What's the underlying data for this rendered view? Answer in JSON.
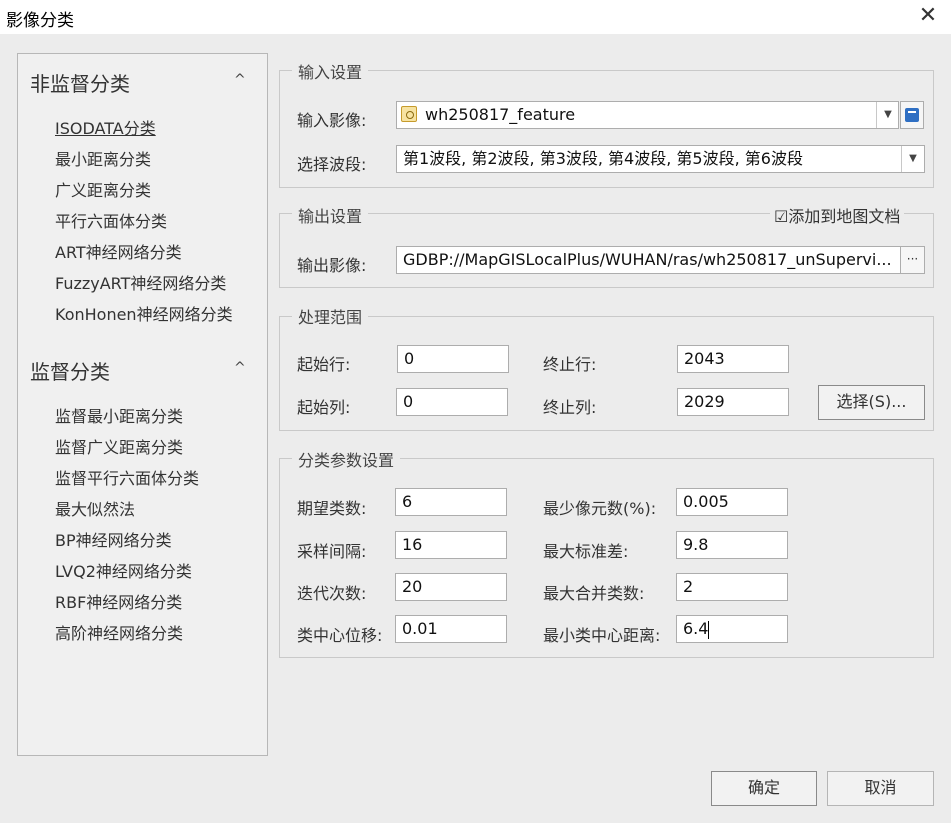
{
  "window": {
    "title": "影像分类",
    "close_glyph": "✕"
  },
  "sidebar": {
    "sections": [
      {
        "title": "非监督分类",
        "items": [
          "ISODATA分类",
          "最小距离分类",
          "广义距离分类",
          "平行六面体分类",
          "ART神经网络分类",
          "FuzzyART神经网络分类",
          "KonHonen神经网络分类"
        ]
      },
      {
        "title": "监督分类",
        "items": [
          "监督最小距离分类",
          "监督广义距离分类",
          "监督平行六面体分类",
          "最大似然法",
          "BP神经网络分类",
          "LVQ2神经网络分类",
          "RBF神经网络分类",
          "高阶神经网络分类"
        ]
      }
    ],
    "active_item": "ISODATA分类",
    "caret_glyph": "^"
  },
  "input_settings": {
    "group_label": "输入设置",
    "image_label": "输入影像:",
    "image_value": "wh250817_feature",
    "band_label": "选择波段:",
    "band_value": "第1波段, 第2波段, 第3波段, 第4波段, 第5波段, 第6波段"
  },
  "output_settings": {
    "group_label": "输出设置",
    "add_to_map_checkbox": "☑添加到地图文档",
    "image_label": "输出影像:",
    "image_value": "GDBP://MapGISLocalPlus/WUHAN/ras/wh250817_unSupervi...",
    "browse_glyph": "···"
  },
  "range": {
    "group_label": "处理范围",
    "start_row_label": "起始行:",
    "start_row": "0",
    "end_row_label": "终止行:",
    "end_row": "2043",
    "start_col_label": "起始列:",
    "start_col": "0",
    "end_col_label": "终止列:",
    "end_col": "2029",
    "select_button": "选择(S)..."
  },
  "params": {
    "group_label": "分类参数设置",
    "expected_classes_label": "期望类数:",
    "expected_classes": "6",
    "min_pixels_label": "最少像元数(%):",
    "min_pixels": "0.005",
    "sample_interval_label": "采样间隔:",
    "sample_interval": "16",
    "max_std_label": "最大标准差:",
    "max_std": "9.8",
    "iterations_label": "迭代次数:",
    "iterations": "20",
    "max_merge_label": "最大合并类数:",
    "max_merge": "2",
    "center_shift_label": "类中心位移:",
    "center_shift": "0.01",
    "min_center_dist_label": "最小类中心距离:",
    "min_center_dist": "6.4"
  },
  "footer": {
    "ok_button": "确定",
    "cancel_button": "取消"
  },
  "colors": {
    "window_bg": "#ececec",
    "field_bg": "#ffffff",
    "border": "#adadad"
  }
}
